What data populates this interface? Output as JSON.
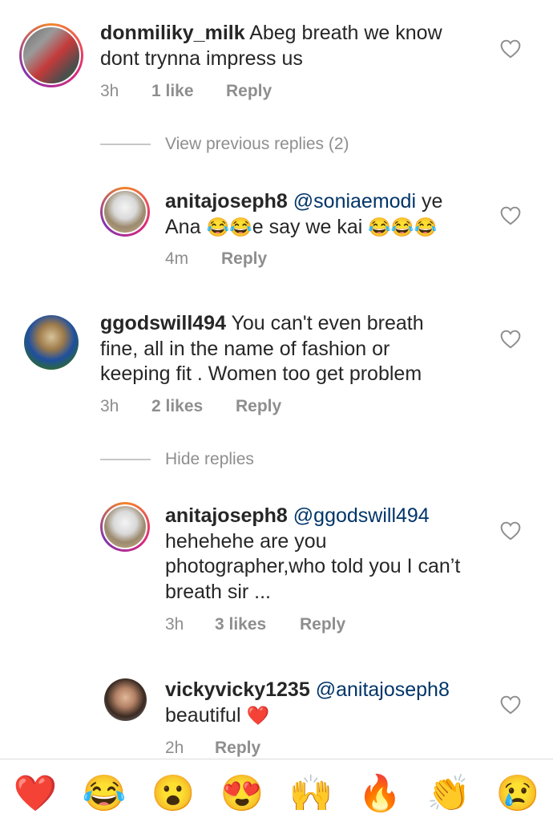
{
  "comments": [
    {
      "username": "donmiliky_milk",
      "text_line1": "Abeg breath we know",
      "text_line2": "dont trynna impress us",
      "time": "3h",
      "likes": "1 like",
      "reply": "Reply"
    },
    {
      "view_previous": "View previous replies (2)"
    },
    {
      "username": "anitajoseph8",
      "mention": "@soniaemodi",
      "text_a": "ye",
      "text_line2_a": "Ana",
      "emoji_a": "😂😂",
      "text_line2_b": "e say we kai",
      "emoji_b": "😂😂😂",
      "time": "4m",
      "reply": "Reply"
    },
    {
      "username": "ggodswill494",
      "text_line1": "You can't even breath",
      "text_line2": "fine, all in the name of fashion or",
      "text_line3": "keeping fit . Women too get problem",
      "time": "3h",
      "likes": "2 likes",
      "reply": "Reply"
    },
    {
      "hide_replies": "Hide replies"
    },
    {
      "username": "anitajoseph8",
      "mention": "@ggodswill494",
      "text_line2": "hehehehe are you",
      "text_line3": "photographer,who told you I can’t",
      "text_line4": "breath sir ...",
      "time": "3h",
      "likes": "3 likes",
      "reply": "Reply"
    },
    {
      "username": "vickyvicky1235",
      "mention": "@anitajoseph8",
      "text_line2": "beautiful",
      "emoji": "❤️",
      "time": "2h",
      "reply": "Reply"
    }
  ],
  "reactions": [
    "❤️",
    "😂",
    "😮",
    "😍",
    "🙌",
    "🔥",
    "👏",
    "😢"
  ],
  "colors": {
    "mention": "#003569",
    "meta": "#8e8e8e",
    "text": "#262626"
  }
}
